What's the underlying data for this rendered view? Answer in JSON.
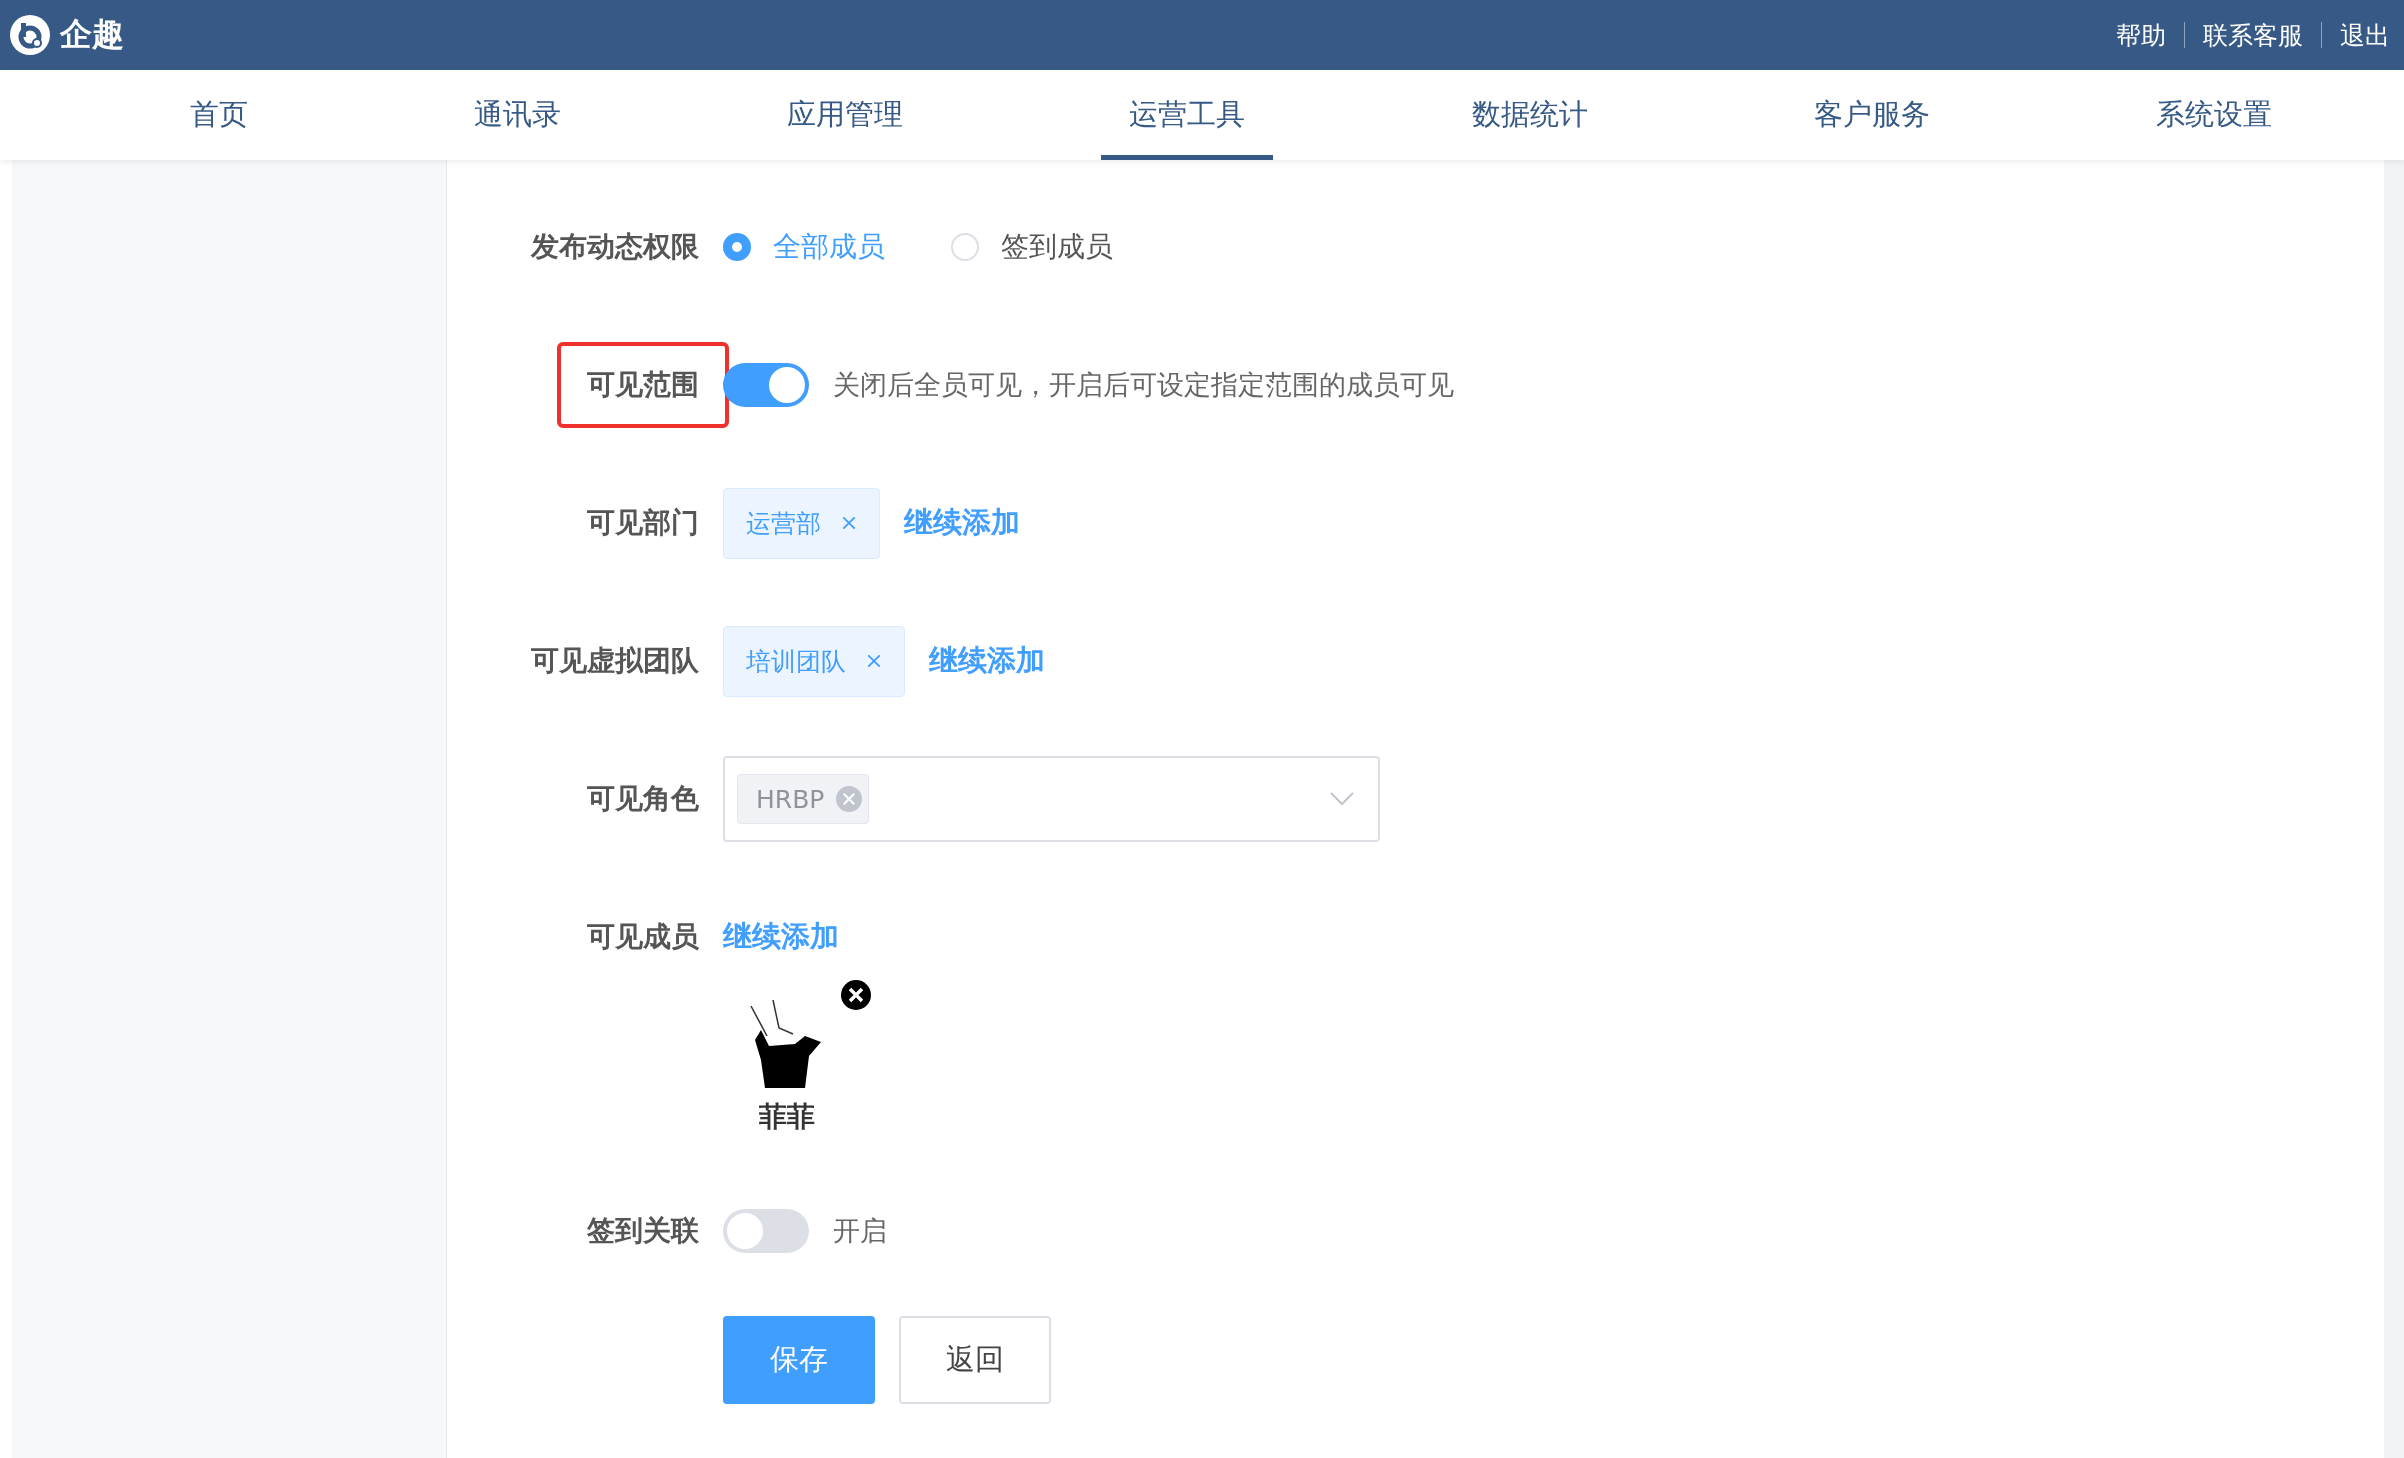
{
  "header": {
    "brand": "企趣",
    "links": [
      "帮助",
      "联系客服",
      "退出"
    ]
  },
  "nav": {
    "tabs": [
      {
        "label": "首页",
        "selected": false
      },
      {
        "label": "通讯录",
        "selected": false
      },
      {
        "label": "应用管理",
        "selected": false
      },
      {
        "label": "运营工具",
        "selected": true
      },
      {
        "label": "数据统计",
        "selected": false
      },
      {
        "label": "客户服务",
        "selected": false
      },
      {
        "label": "系统设置",
        "selected": false
      }
    ]
  },
  "form": {
    "rows": [
      {
        "kind": "radio",
        "label": "发布动态权限",
        "highlighted": false,
        "options": [
          {
            "label": "全部成员",
            "selected": true
          },
          {
            "label": "签到成员",
            "selected": false
          }
        ]
      },
      {
        "kind": "switch",
        "label": "可见范围",
        "highlighted": true,
        "on": true,
        "hint": "关闭后全员可见，开启后可设定指定范围的成员可见"
      },
      {
        "kind": "tags",
        "label": "可见部门",
        "highlighted": false,
        "tags": [
          "运营部"
        ],
        "add_link": "继续添加"
      },
      {
        "kind": "tags",
        "label": "可见虚拟团队",
        "highlighted": false,
        "tags": [
          "培训团队"
        ],
        "add_link": "继续添加"
      },
      {
        "kind": "select",
        "label": "可见角色",
        "highlighted": false,
        "tags": [
          "HRBP"
        ]
      },
      {
        "kind": "members",
        "label": "可见成员",
        "highlighted": false,
        "add_link": "继续添加",
        "members": [
          {
            "name": "菲菲"
          }
        ]
      },
      {
        "kind": "switch",
        "label": "签到关联",
        "highlighted": false,
        "on": false,
        "hint": "开启"
      }
    ],
    "buttons": [
      {
        "kind": "primary",
        "label": "保存"
      },
      {
        "kind": "default",
        "label": "返回"
      }
    ]
  }
}
